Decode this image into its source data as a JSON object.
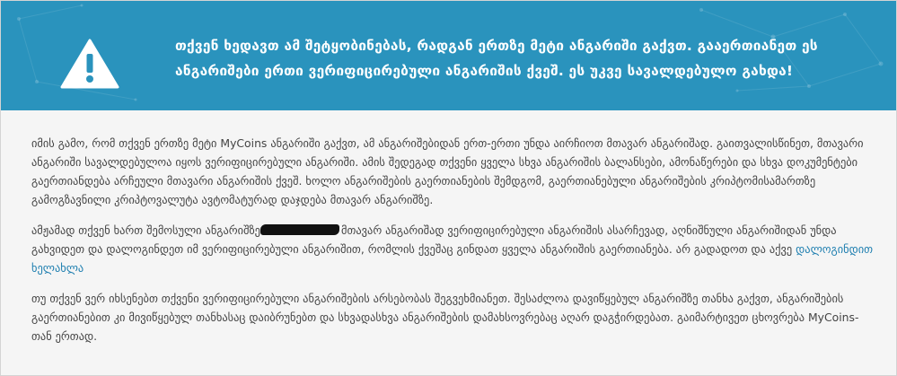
{
  "banner": {
    "color": "#2a93bd",
    "icon": "warning-triangle-icon",
    "message": "თქვენ ხედავთ ამ შეტყობინებას, რადგან ერთზე მეტი ანგარიში გაქვთ. გააერთიანეთ ეს ანგარიშები ერთი ვერიფიცირებული ანგარიშის ქვეშ. ეს უკვე სავალდებულო გახდა!"
  },
  "content": {
    "paragraph1": "იმის გამო, რომ თქვენ ერთზე მეტი MyCoins ანგარიში გაქვთ, ამ ანგარიშებიდან ერთ-ერთი უნდა აირჩიოთ მთავარ ანგარიშად. გაითვალისწინეთ, მთავარი ანგარიში სავალდებულოა იყოს ვერიფიცირებული ანგარიში. ამის შედეგად თქვენი ყველა სხვა ანგარიშის ბალანსები, ამონაწერები და სხვა დოკუმენტები გაერთიანდება არჩეული მთავარი ანგარიშის ქვეშ. ხოლო ანგარიშების გაერთიანების შემდგომ, გაერთიანებული ანგარიშების კრიპტომისამართზე გამოგზავნილი კრიპტოვალუტა ავტომატურად დაჯდება მთავარ ანგარიშზე.",
    "paragraph2_before": "ამჟამად თქვენ ხართ შემოსული ანგარიშზე",
    "paragraph2_after": "მთავარ ანგარიშად ვერიფიცირებული ანგარიშის ასარჩევად, აღნიშნული ანგარიშიდან უნდა გახვიდეთ და დალოგინდეთ იმ ვერიფიცირებული ანგარიშით, რომლის ქვეშაც გინდათ ყველა ანგარიშის გაერთიანება. არ გადადოთ და აქვე",
    "relogin_link": "დალოგინდით ხელახლა",
    "paragraph3": "თუ თქვენ ვერ იხსენებთ თქვენი ვერიფიცირებული ანგარიშების არსებობას შეგვეხმიანეთ. შესაძლოა დავიწყებულ ანგარიშზე თანხა გაქვთ, ანგარიშების გაერთიანებით კი მივიწყებულ თანხასაც დაიბრუნებთ და სხვადასხვა ანგარიშების დამახსოვრებაც აღარ დაგჭირდებათ. გაიმარტივეთ ცხოვრება MyCoins-თან ერთად."
  }
}
